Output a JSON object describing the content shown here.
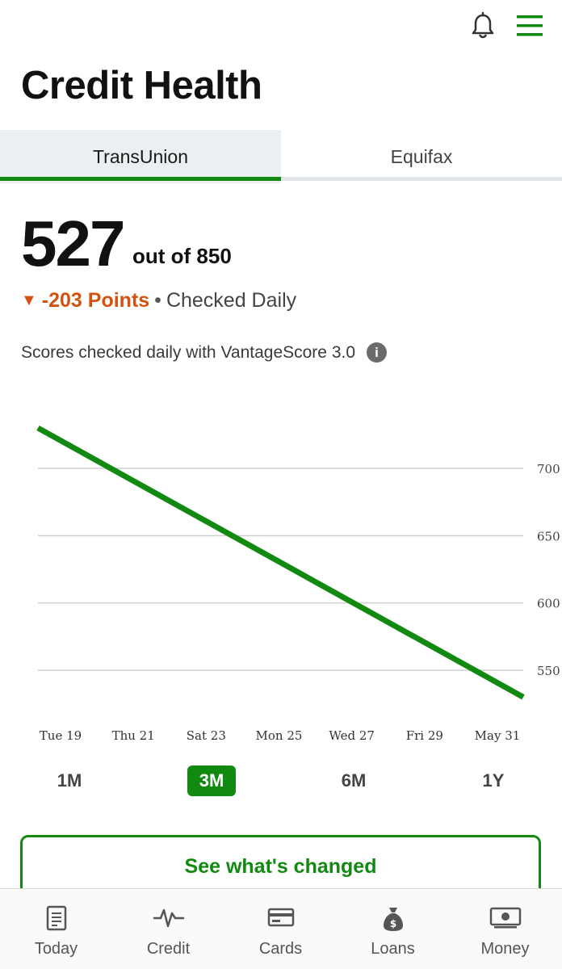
{
  "header": {
    "title": "Credit Health",
    "bell_icon": "bell-icon",
    "menu_icon": "hamburger-menu-icon",
    "accent": "#128a12"
  },
  "tabs": [
    {
      "label": "TransUnion",
      "active": true
    },
    {
      "label": "Equifax",
      "active": false
    }
  ],
  "score": {
    "value": "527",
    "out_of": "out of 850",
    "change_arrow": "▼",
    "change": "-203 Points",
    "separator": "•",
    "frequency": "Checked Daily",
    "note": "Scores checked daily with VantageScore 3.0",
    "info_icon": "i",
    "change_color": "#d4520f"
  },
  "chart_data": {
    "type": "line",
    "x": [
      "Tue 19",
      "Thu 21",
      "Sat 23",
      "Mon 25",
      "Wed 27",
      "Fri 29",
      "May 31"
    ],
    "series": [
      {
        "values": [
          730,
          530
        ],
        "x_start": "Tue 19",
        "x_end": "May 31",
        "color": "#128a12"
      }
    ],
    "yticks": [
      550,
      600,
      650,
      700
    ],
    "ylim": [
      525,
      735
    ],
    "grid": true
  },
  "ranges": [
    {
      "label": "1M",
      "active": false
    },
    {
      "label": "3M",
      "active": true
    },
    {
      "label": "6M",
      "active": false
    },
    {
      "label": "1Y",
      "active": false
    }
  ],
  "cta": {
    "label": "See what's changed"
  },
  "bottom_nav": [
    {
      "label": "Today",
      "icon": "document-icon"
    },
    {
      "label": "Credit",
      "icon": "pulse-icon"
    },
    {
      "label": "Cards",
      "icon": "credit-card-icon"
    },
    {
      "label": "Loans",
      "icon": "money-bag-icon"
    },
    {
      "label": "Money",
      "icon": "cash-bill-icon"
    }
  ]
}
